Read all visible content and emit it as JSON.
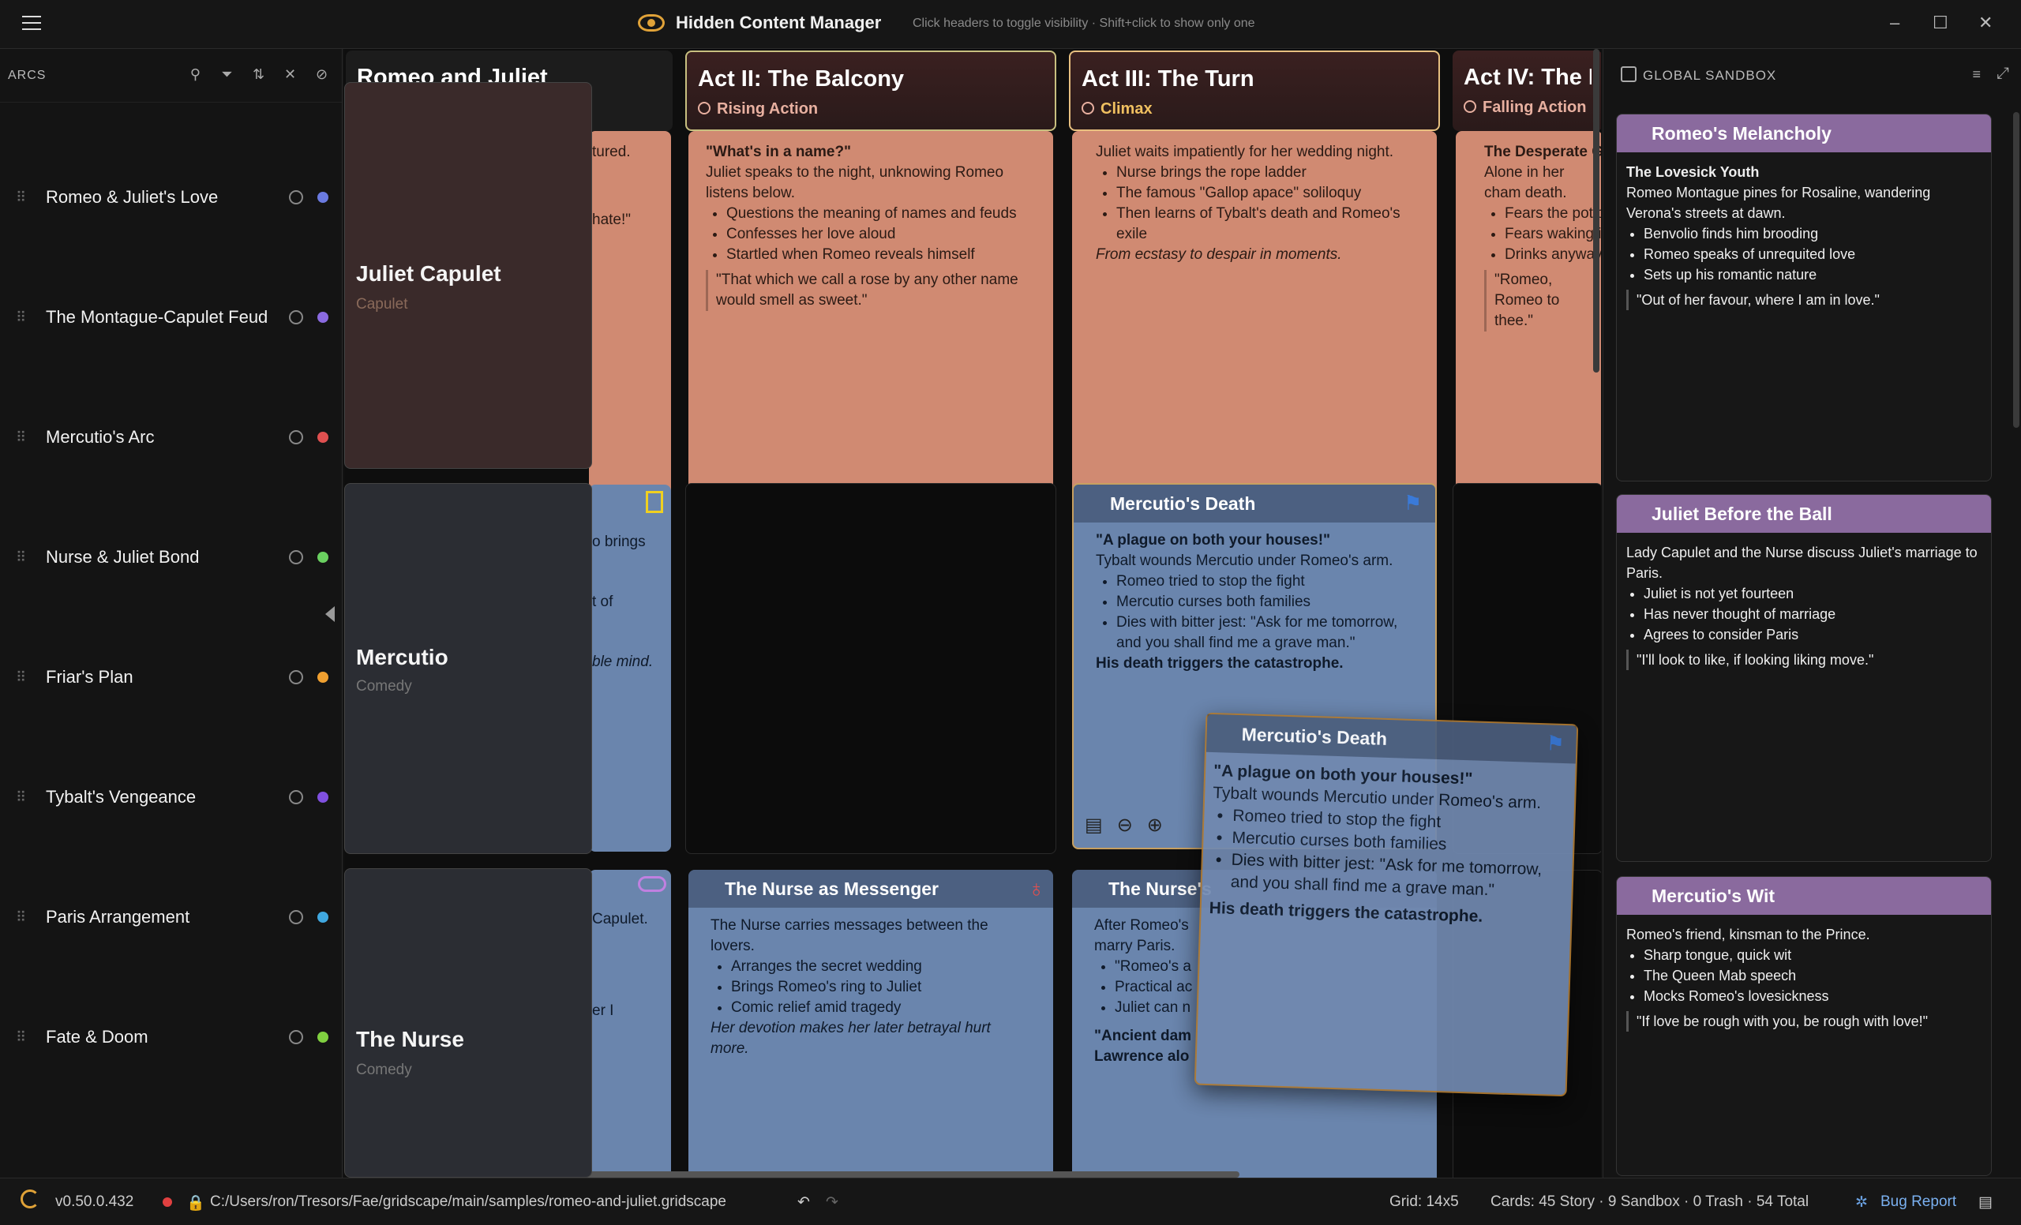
{
  "app": {
    "title": "Hidden Content Manager",
    "hint": "Click headers to toggle visibility · Shift+click to show only one"
  },
  "sidebar": {
    "header": "ARCS",
    "arcs": [
      {
        "label": "Romeo & Juliet's Love",
        "color": "#6a7ae0"
      },
      {
        "label": "The Montague-Capulet Feud",
        "color": "#8a6ae0"
      },
      {
        "label": "Mercutio's Arc",
        "color": "#e05050"
      },
      {
        "label": "Nurse & Juliet Bond",
        "color": "#6ad060"
      },
      {
        "label": "Friar's Plan",
        "color": "#f0a030"
      },
      {
        "label": "Tybalt's Vengeance",
        "color": "#8050e0"
      },
      {
        "label": "Paris Arrangement",
        "color": "#40a8e0"
      },
      {
        "label": "Fate & Doom",
        "color": "#80d040"
      }
    ]
  },
  "grid": {
    "columns": [
      {
        "title": "Romeo and Juliet",
        "subtitle": ""
      },
      {
        "title": "Act II: The Balcony",
        "subtitle": "Rising Action"
      },
      {
        "title": "Act III: The Turn",
        "subtitle": "Climax"
      },
      {
        "title": "Act IV: The Pl",
        "subtitle": "Falling Action"
      }
    ],
    "characters": [
      {
        "name": "Juliet Capulet",
        "group": "Capulet"
      },
      {
        "name": "Mercutio",
        "group": "Comedy"
      },
      {
        "name": "The Nurse",
        "group": "Comedy"
      }
    ],
    "fragments": {
      "c0r0a": "tured.",
      "c0r0b": "hate!\"",
      "c0r1a": "o brings",
      "c0r1b": "t of",
      "c0r1c": "ble mind.",
      "c0r2a": "Capulet.",
      "c0r2b": "er I"
    },
    "balcony": {
      "quote_title": "\"What's in a name?\"",
      "text": "Juliet speaks to the night, unknowing Romeo listens below.",
      "bullets": [
        "Questions the meaning of names and feuds",
        "Confesses her love aloud",
        "Startled when Romeo reveals himself"
      ],
      "quote": "\"That which we call a rose by any other name would smell as sweet.\""
    },
    "turn": {
      "text": "Juliet waits impatiently for her wedding night.",
      "bullets": [
        "Nurse brings the rope ladder",
        "The famous \"Gallop apace\" soliloquy",
        "Then learns of Tybalt's death and Romeo's exile"
      ],
      "closing": "From ecstasy to despair in moments."
    },
    "act4": {
      "title": "The Desperate Ga",
      "text": "Alone in her cham death.",
      "bullets": [
        "Fears the potio",
        "Fears waking i",
        "Drinks anyway"
      ],
      "quote": "\"Romeo, Romeo to thee.\""
    },
    "mercutio_death": {
      "title": "Mercutio's Death",
      "quote_title": "\"A plague on both your houses!\"",
      "text": "Tybalt wounds Mercutio under Romeo's arm.",
      "bullets": [
        "Romeo tried to stop the fight",
        "Mercutio curses both families",
        "Dies with bitter jest: \"Ask for me tomorrow, and you shall find me a grave man.\""
      ],
      "closing": "His death triggers the catastrophe."
    },
    "nurse_messenger": {
      "title": "The Nurse as Messenger",
      "text": "The Nurse carries messages between the lovers.",
      "bullets": [
        "Arranges the secret wedding",
        "Brings Romeo's ring to Juliet",
        "Comic relief amid tragedy"
      ],
      "closing": "Her devotion makes her later betrayal hurt more."
    },
    "nurse_betrayal": {
      "title": "The Nurse's",
      "text": "After Romeo's marry Paris.",
      "bullets": [
        "\"Romeo's a",
        "Practical ac",
        "Juliet can n"
      ],
      "closing": "\"Ancient dam Lawrence alo"
    }
  },
  "sandbox": {
    "header": "GLOBAL SANDBOX",
    "cards": [
      {
        "title": "Romeo's Melancholy",
        "subtitle": "The Lovesick Youth",
        "text": "Romeo Montague pines for Rosaline, wandering Verona's streets at dawn.",
        "bullets": [
          "Benvolio finds him brooding",
          "Romeo speaks of unrequited love",
          "Sets up his romantic nature"
        ],
        "quote": "\"Out of her favour, where I am in love.\""
      },
      {
        "title": "Juliet Before the Ball",
        "subtitle": "",
        "text": "Lady Capulet and the Nurse discuss Juliet's marriage to Paris.",
        "bullets": [
          "Juliet is not yet fourteen",
          "Has never thought of marriage",
          "Agrees to consider Paris"
        ],
        "quote": "\"I'll look to like, if looking liking move.\""
      },
      {
        "title": "Mercutio's Wit",
        "subtitle": "",
        "text": "Romeo's friend, kinsman to the Prince.",
        "bullets": [
          "Sharp tongue, quick wit",
          "The Queen Mab speech",
          "Mocks Romeo's lovesickness"
        ],
        "quote": "\"If love be rough with you, be rough with love!\""
      }
    ]
  },
  "status": {
    "version": "v0.50.0.432",
    "path": "C:/Users/ron/Tresors/Fae/gridscape/main/samples/romeo-and-juliet.gridscape",
    "grid": "Grid: 14x5",
    "cards": "Cards: 45 Story · 9 Sandbox · 0 Trash · 54 Total",
    "bug": "Bug Report"
  },
  "colors": {
    "accent": "#e0a238",
    "salmon": "#d08a72",
    "blue": "#6a85ad",
    "sandbox_title": "#8a6a9e"
  }
}
